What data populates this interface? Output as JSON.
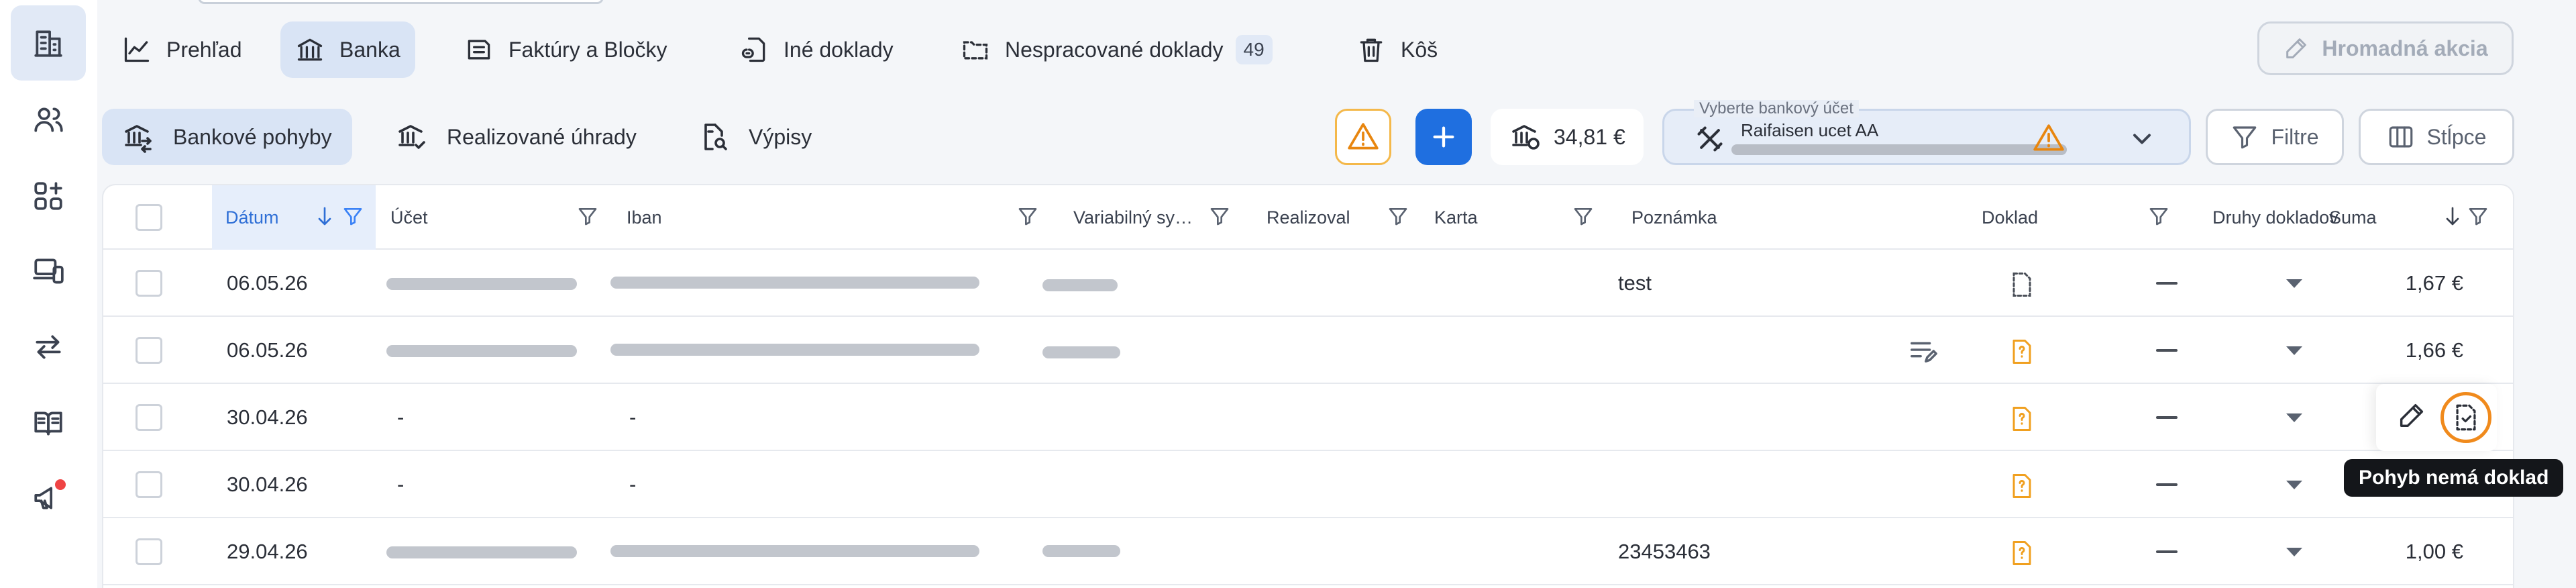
{
  "top_tabs": {
    "overview": "Prehľad",
    "bank": "Banka",
    "invoices": "Faktúry a Bločky",
    "other_docs": "Iné doklady",
    "unprocessed": "Nespracované doklady",
    "unprocessed_count": "49",
    "trash": "Kôš"
  },
  "mass_action": "Hromadná akcia",
  "sub_tabs": {
    "bank_moves": "Bankové pohyby",
    "payments": "Realizované úhrady",
    "statements": "Výpisy"
  },
  "balance": "34,81 €",
  "account": {
    "legend": "Vyberte bankový účet",
    "name": "Raifaisen ucet AA"
  },
  "buttons": {
    "filters": "Filtre",
    "columns": "Stĺpce"
  },
  "columns": {
    "date": "Dátum",
    "account": "Účet",
    "iban": "Iban",
    "variable": "Variabilný sy…",
    "realized": "Realizoval",
    "card": "Karta",
    "note": "Poznámka",
    "doc": "Doklad",
    "doc_types": "Druhy dokladov",
    "sum": "Suma"
  },
  "rows": [
    {
      "date": "06.05.26",
      "account": "",
      "iban": "",
      "note": "test",
      "sum": "1,67 €"
    },
    {
      "date": "06.05.26",
      "account": "",
      "iban": "",
      "note": "",
      "sum": "1,66 €"
    },
    {
      "date": "30.04.26",
      "account": "-",
      "iban": "-",
      "note": "",
      "sum": ""
    },
    {
      "date": "30.04.26",
      "account": "-",
      "iban": "-",
      "note": "",
      "sum": ""
    },
    {
      "date": "29.04.26",
      "account": "",
      "iban": "",
      "note": "23453463",
      "sum": "1,00 €"
    }
  ],
  "tooltip": "Pohyb nemá doklad",
  "colors": {
    "accent": "#1f6fe0",
    "active_bg": "#d9e4f5",
    "warning": "#e8860f",
    "doc_missing": "#f0a020"
  }
}
